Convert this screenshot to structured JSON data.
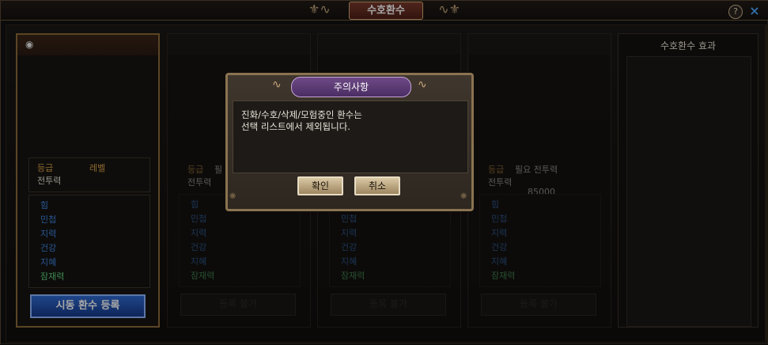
{
  "window": {
    "title": "수호환수",
    "help_symbol": "?",
    "close_symbol": "×"
  },
  "slots": [
    {
      "state": "active",
      "visible_icon": "eye-icon",
      "grade_label": "등급",
      "level_label": "레벨",
      "power_label": "전투력",
      "stats": [
        "힘",
        "민첩",
        "지력",
        "건강",
        "지혜",
        "잠재력"
      ],
      "button_label": "시동 환수 등록"
    },
    {
      "state": "empty",
      "grade_label": "등급",
      "required_label": "필",
      "power_label": "전투력",
      "stats": [
        "힘",
        "민첩",
        "지력",
        "건강",
        "지혜",
        "잠재력"
      ],
      "button_label": "등록 불가"
    },
    {
      "state": "empty",
      "grade_label": "",
      "power_label": "",
      "stats": [
        "민첩",
        "지력",
        "건강",
        "지혜",
        "잠재력"
      ],
      "button_label": "등록 불가"
    },
    {
      "state": "empty",
      "grade_label": "등급",
      "required_label": "필요 전투력",
      "power_label": "전투력",
      "required_value": "85000",
      "stats": [
        "힘",
        "민첩",
        "지력",
        "건강",
        "지혜",
        "잠재력"
      ],
      "button_label": "등록 불가"
    }
  ],
  "effect_panel": {
    "title": "수호환수 효과"
  },
  "dialog": {
    "title": "주의사항",
    "message": "진화/수호/삭제/모험중인 환수는\n선택 리스트에서 제외됩니다.",
    "confirm_label": "확인",
    "cancel_label": "취소"
  },
  "colors": {
    "label_gold": "#d9a24a",
    "stat_blue": "#3f86e0",
    "stat_green": "#5fd07a",
    "accent_blue": "#2f6bd1"
  }
}
